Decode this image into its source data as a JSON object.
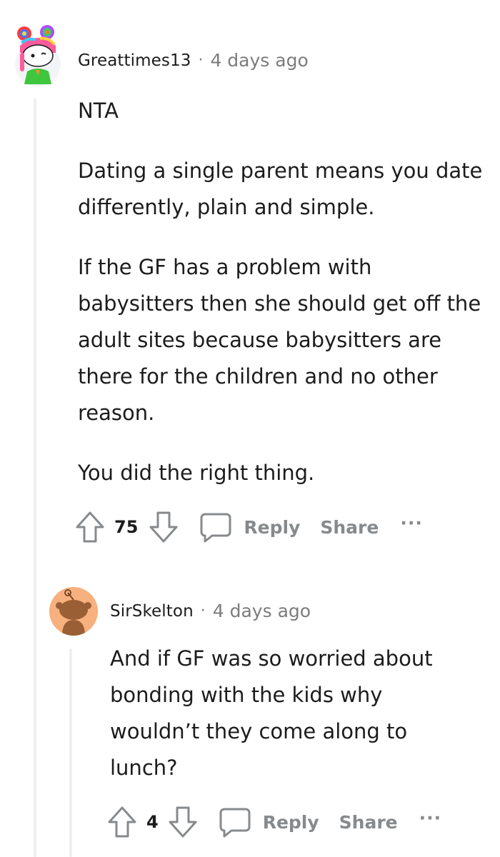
{
  "comments": [
    {
      "username": "Greattimes13",
      "separator": "·",
      "time": "4 days ago",
      "paragraphs": [
        "NTA",
        "Dating a single parent means you date differently, plain and simple.",
        "If the GF has a problem with babysitters then she should get off the adult sites because babysitters are there for the children and no other reason.",
        "You did the right thing."
      ],
      "score": "75",
      "reply_label": "Reply",
      "share_label": "Share",
      "more_label": "···"
    },
    {
      "username": "SirSkelton",
      "separator": "·",
      "time": "4 days ago",
      "paragraphs": [
        "And if GF was so worried about bonding with the kids why wouldn’t they come along to lunch?"
      ],
      "score": "4",
      "reply_label": "Reply",
      "share_label": "Share",
      "more_label": "···"
    }
  ],
  "colors": {
    "text": "#1c1c1c",
    "meta": "#7c7c7c",
    "action": "#878a8c",
    "thread_line": "#edeff1",
    "avatar2_bg": "#f6b17f"
  }
}
